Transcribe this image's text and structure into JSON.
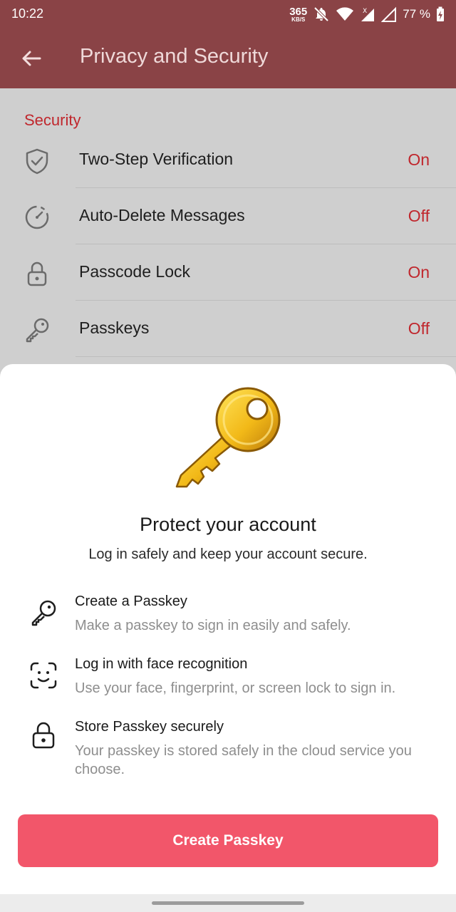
{
  "status_bar": {
    "time": "10:22",
    "speed_value": "365",
    "speed_unit": "KB/S",
    "battery": "77 %",
    "icons": [
      "bell-off-icon",
      "wifi-icon",
      "cell-signal-x-icon",
      "cell-signal-icon",
      "battery-charging-icon"
    ]
  },
  "header": {
    "back_icon": "arrow-left-icon",
    "title": "Privacy and Security",
    "color": "#8a4346"
  },
  "security": {
    "section_title": "Security",
    "items": [
      {
        "icon": "shield-check-icon",
        "label": "Two-Step Verification",
        "value": "On"
      },
      {
        "icon": "timer-icon",
        "label": "Auto-Delete Messages",
        "value": "Off"
      },
      {
        "icon": "lock-icon",
        "label": "Passcode Lock",
        "value": "On"
      },
      {
        "icon": "key-icon",
        "label": "Passkeys",
        "value": "Off"
      }
    ]
  },
  "sheet": {
    "illustration": "golden-key-icon",
    "title": "Protect your account",
    "subtitle": "Log in safely and keep your account secure.",
    "features": [
      {
        "icon": "key-icon",
        "title": "Create a Passkey",
        "desc": "Make a passkey to sign in easily and safely."
      },
      {
        "icon": "face-scan-icon",
        "title": "Log in with face recognition",
        "desc": "Use your face, fingerprint, or screen lock to sign in."
      },
      {
        "icon": "lock-icon",
        "title": "Store Passkey securely",
        "desc": "Your passkey is stored safely in the cloud service you choose."
      }
    ],
    "button_label": "Create Passkey",
    "button_color": "#f2566a"
  }
}
